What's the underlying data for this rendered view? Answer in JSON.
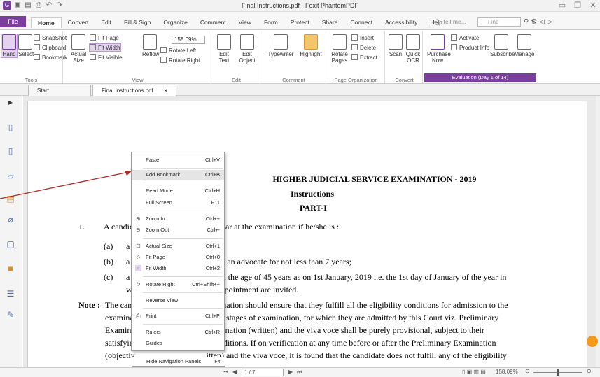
{
  "titlebar": {
    "title": "Final Instructions.pdf - Foxit PhantomPDF"
  },
  "menu": {
    "file": "File",
    "tabs": [
      "Home",
      "Convert",
      "Edit",
      "Fill & Sign",
      "Organize",
      "Comment",
      "View",
      "Form",
      "Protect",
      "Share",
      "Connect",
      "Accessibility",
      "Help"
    ],
    "active_tab": "Home",
    "tellme": "Tell me...",
    "find_placeholder": "Find"
  },
  "ribbon": {
    "tools": {
      "hand": "Hand",
      "select": "Select",
      "snapshot": "SnapShot",
      "clipboard": "Clipboard",
      "bookmark": "Bookmark",
      "label": "Tools"
    },
    "view": {
      "actual_size": "Actual Size",
      "fit_page": "Fit Page",
      "fit_width": "Fit Width",
      "fit_visible": "Fit Visible",
      "reflow": "Reflow",
      "zoom": "158.09%",
      "rotate_left": "Rotate Left",
      "rotate_right": "Rotate Right",
      "label": "View"
    },
    "edit": {
      "edit_text": "Edit Text",
      "edit_object": "Edit Object",
      "label": "Edit"
    },
    "comment": {
      "typewriter": "Typewriter",
      "highlight": "Highlight",
      "label": "Comment"
    },
    "page_org": {
      "rotate_pages": "Rotate Pages",
      "insert": "Insert",
      "delete": "Delete",
      "extract": "Extract",
      "label": "Page Organization"
    },
    "convert": {
      "scan": "Scan",
      "quick_ocr": "Quick OCR",
      "label": "Convert"
    },
    "evaluation": {
      "purchase_now": "Purchase Now",
      "activate": "Activate",
      "product_info": "Product Info",
      "subscribe": "Subscribe",
      "manage": "Manage",
      "label": "Evaluation (Day 1 of 14)"
    }
  },
  "doctabs": {
    "start": "Start",
    "file": "Final Instructions.pdf",
    "close": "×"
  },
  "document": {
    "heading": "HIGHER JUDICIAL SERVICE EXAMINATION - 2019",
    "instructions": "Instructions",
    "part": "PART-I",
    "p1_num": "1.",
    "p1_text": "A candidate shall be eligible to appear at the examination if he/she is :",
    "a_label": "(a)",
    "a_text": "a",
    "b_label": "(b)",
    "b_text": "a                                          as an advocate for not less than 7 years;",
    "c_label": "(c)",
    "c_text": "a                                          ed the age of 45 years as on 1st January, 2019 i.e. the 1st day of January of the year in",
    "c_text2": "w                                          ppointment are invited.",
    "note_label": "Note :",
    "note1": "The can                                   xamination should ensure that they fulfill all the eligibility conditions for admission to the",
    "note2": "examina                                   ll the stages of examination, for which they are admitted by this Court viz. Preliminary",
    "note3": "Examina                                   xamination (written) and the viva voce shall be purely provisional, subject to their",
    "note4": "satisfyin                                  y conditions. If on verification at any time before or after the Preliminary Examination",
    "note5": "(objectiv                                  itten) and the viva voce, it is found that the candidate does not fulfill any of the eligibility"
  },
  "context_menu": {
    "items": [
      {
        "label": "Paste",
        "shortcut": "Ctrl+V"
      },
      {
        "label": "Add Bookmark",
        "shortcut": "Ctrl+B"
      },
      {
        "label": "Read Mode",
        "shortcut": "Ctrl+H"
      },
      {
        "label": "Full Screen",
        "shortcut": "F11"
      },
      {
        "label": "Zoom In",
        "shortcut": "Ctrl++"
      },
      {
        "label": "Zoom Out",
        "shortcut": "Ctrl+-"
      },
      {
        "label": "Actual Size",
        "shortcut": "Ctrl+1"
      },
      {
        "label": "Fit Page",
        "shortcut": "Ctrl+0"
      },
      {
        "label": "Fit Width",
        "shortcut": "Ctrl+2"
      },
      {
        "label": "Rotate Right",
        "shortcut": "Ctrl+Shift++"
      },
      {
        "label": "Reverse View",
        "shortcut": ""
      },
      {
        "label": "Print",
        "shortcut": "Ctrl+P"
      },
      {
        "label": "Rulers",
        "shortcut": "Ctrl+R"
      },
      {
        "label": "Guides",
        "shortcut": ""
      },
      {
        "label": "Hide Navigation Panels",
        "shortcut": "F4"
      }
    ]
  },
  "statusbar": {
    "page": "1 / 7",
    "zoom": "158.09%"
  },
  "colors": {
    "accent": "#7a3e9d",
    "arrow": "#b02a2a"
  }
}
